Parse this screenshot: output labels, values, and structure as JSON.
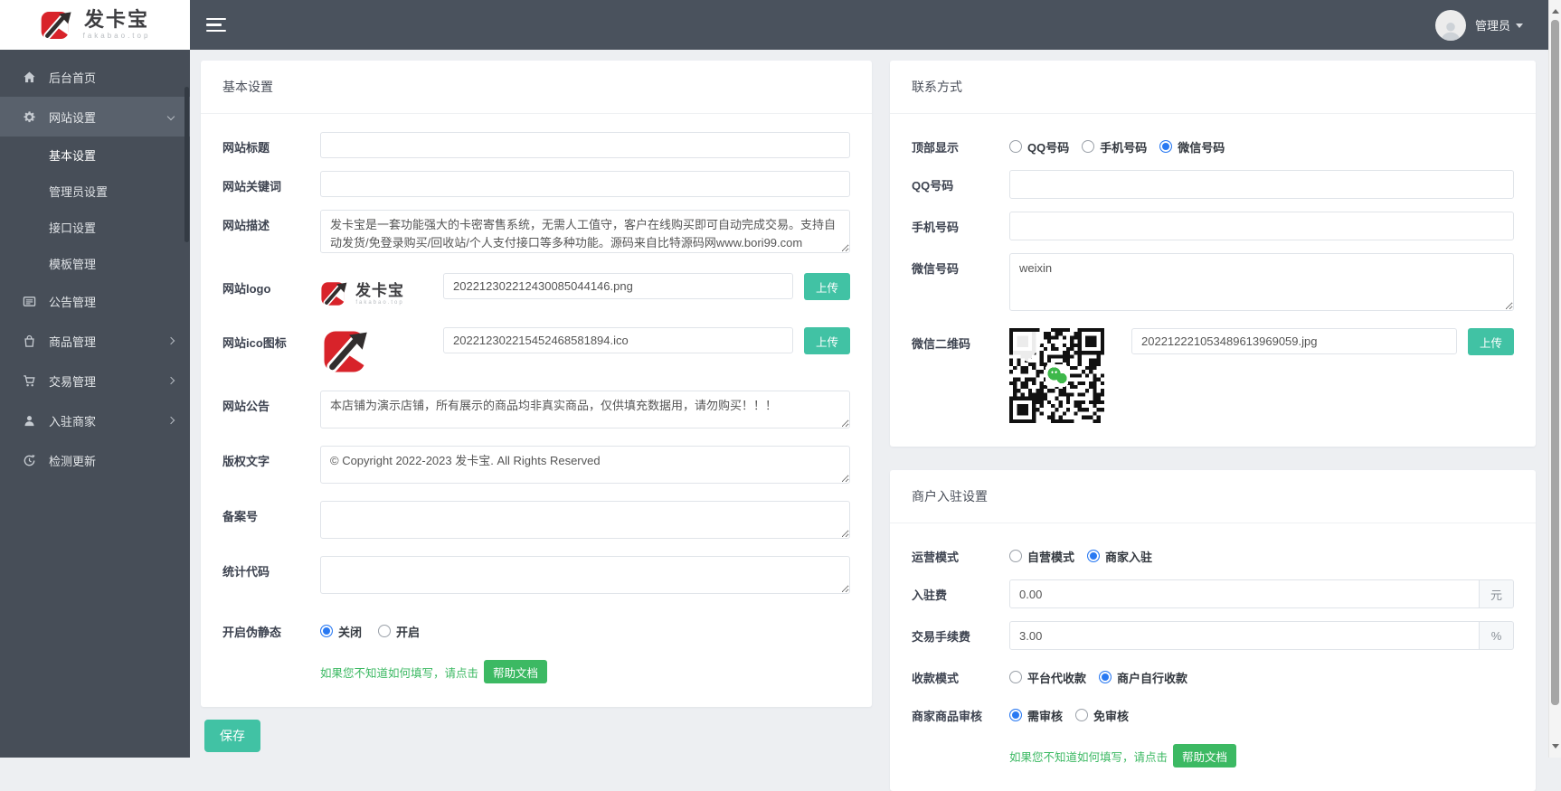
{
  "brand": {
    "name": "发卡宝",
    "domain": "fakabao.top"
  },
  "topbar": {
    "user": "管理员"
  },
  "sidebar": {
    "items": [
      {
        "label": "后台首页"
      },
      {
        "label": "网站设置",
        "children": [
          {
            "label": "基本设置"
          },
          {
            "label": "管理员设置"
          },
          {
            "label": "接口设置"
          },
          {
            "label": "模板管理"
          }
        ]
      },
      {
        "label": "公告管理"
      },
      {
        "label": "商品管理"
      },
      {
        "label": "交易管理"
      },
      {
        "label": "入驻商家"
      },
      {
        "label": "检测更新"
      }
    ]
  },
  "basic": {
    "title": "基本设置",
    "site_title": {
      "label": "网站标题",
      "value": ""
    },
    "keywords": {
      "label": "网站关键词",
      "value": ""
    },
    "description": {
      "label": "网站描述",
      "value": "发卡宝是一套功能强大的卡密寄售系统，无需人工值守，客户在线购买即可自动完成交易。支持自动发货/免登录购买/回收站/个人支付接口等多种功能。源码来自比特源码网www.bori99.com"
    },
    "logo": {
      "label": "网站logo",
      "filename": "202212302212430085044146.png",
      "upload": "上传"
    },
    "ico": {
      "label": "网站ico图标",
      "filename": "202212302215452468581894.ico",
      "upload": "上传"
    },
    "notice": {
      "label": "网站公告",
      "value": "本店铺为演示店铺，所有展示的商品均非真实商品，仅供填充数据用，请勿购买！！！"
    },
    "copyright": {
      "label": "版权文字",
      "value": "© Copyright 2022-2023 发卡宝. All Rights Reserved"
    },
    "icp": {
      "label": "备案号",
      "value": ""
    },
    "stats": {
      "label": "统计代码",
      "value": ""
    },
    "rewrite": {
      "label": "开启伪静态",
      "options": [
        {
          "label": "关闭"
        },
        {
          "label": "开启"
        }
      ],
      "selected": "关闭"
    },
    "help": {
      "text": "如果您不知道如何填写，请点击",
      "button": "帮助文档"
    },
    "save": "保存"
  },
  "contact": {
    "title": "联系方式",
    "top_display": {
      "label": "顶部显示",
      "options": [
        {
          "label": "QQ号码"
        },
        {
          "label": "手机号码"
        },
        {
          "label": "微信号码"
        }
      ],
      "selected": "微信号码"
    },
    "qq": {
      "label": "QQ号码",
      "value": ""
    },
    "phone": {
      "label": "手机号码",
      "value": ""
    },
    "wechat": {
      "label": "微信号码",
      "value": "weixin"
    },
    "wechat_qr": {
      "label": "微信二维码",
      "filename": "202212221053489613969059.jpg",
      "upload": "上传"
    }
  },
  "merchant": {
    "title": "商户入驻设置",
    "mode": {
      "label": "运营模式",
      "options": [
        {
          "label": "自营模式"
        },
        {
          "label": "商家入驻"
        }
      ],
      "selected": "商家入驻"
    },
    "entry_fee": {
      "label": "入驻费",
      "value": "0.00",
      "unit": "元"
    },
    "commission": {
      "label": "交易手续费",
      "value": "3.00",
      "unit": "%"
    },
    "collection": {
      "label": "收款模式",
      "options": [
        {
          "label": "平台代收款"
        },
        {
          "label": "商户自行收款"
        }
      ],
      "selected": "商户自行收款"
    },
    "review": {
      "label": "商家商品审核",
      "options": [
        {
          "label": "需审核"
        },
        {
          "label": "免审核"
        }
      ],
      "selected": "需审核"
    },
    "help": {
      "text": "如果您不知道如何填写，请点击",
      "button": "帮助文档"
    }
  },
  "colors": {
    "accent_teal": "#41c2a4",
    "help_green": "#3cb963",
    "radio_blue": "#2979f2",
    "sidebar_bg": "#474e58",
    "brand_red": "#d8232a"
  }
}
